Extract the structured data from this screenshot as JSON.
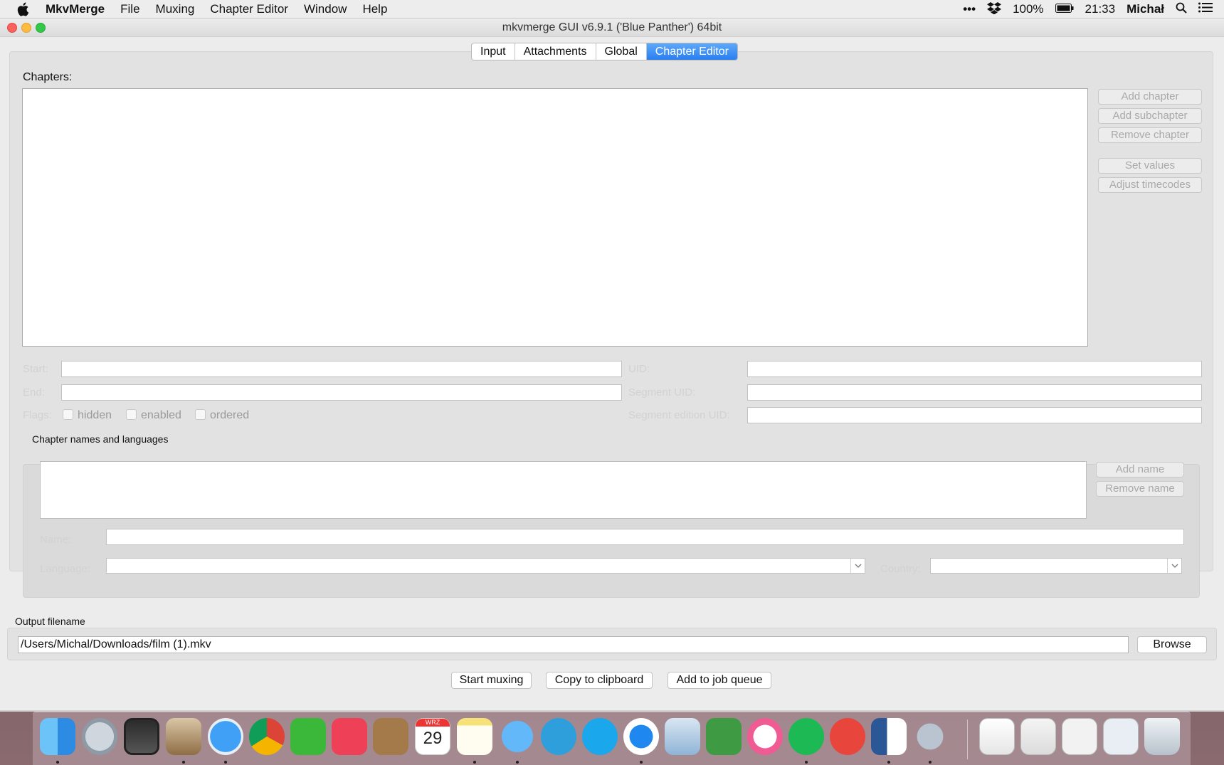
{
  "menubar": {
    "app_name": "MkvMerge",
    "items": [
      "File",
      "Muxing",
      "Chapter Editor",
      "Window",
      "Help"
    ],
    "status": {
      "more": "•••",
      "battery": "100%",
      "time": "21:33",
      "user": "Michał"
    }
  },
  "window": {
    "title": "mkvmerge GUI v6.9.1 ('Blue Panther') 64bit",
    "tabs": [
      "Input",
      "Attachments",
      "Global",
      "Chapter Editor"
    ],
    "active_tab": "Chapter Editor"
  },
  "chapters": {
    "label": "Chapters:",
    "buttons": {
      "add_chapter": "Add chapter",
      "add_subchapter": "Add subchapter",
      "remove_chapter": "Remove chapter",
      "set_values": "Set values",
      "adjust_timecodes": "Adjust timecodes"
    },
    "fields": {
      "start": "Start:",
      "end": "End:",
      "flags": "Flags:",
      "uid": "UID:",
      "segment_uid": "Segment UID:",
      "segment_edition_uid": "Segment edition UID:"
    },
    "flags": {
      "hidden": "hidden",
      "enabled": "enabled",
      "ordered": "ordered"
    }
  },
  "names": {
    "group_label": "Chapter names and languages",
    "add_name": "Add name",
    "remove_name": "Remove name",
    "name_label": "Name:",
    "language_label": "Language:",
    "country_label": "Country:"
  },
  "output": {
    "label": "Output filename",
    "value": "/Users/Michal/Downloads/film (1).mkv",
    "browse": "Browse"
  },
  "actions": {
    "start_muxing": "Start muxing",
    "copy_to_clipboard": "Copy to clipboard",
    "add_to_job_queue": "Add to job queue"
  },
  "dock": {
    "calendar_month": "WRZ",
    "calendar_day": "29",
    "apps": [
      "Finder",
      "Launchpad",
      "Photo Slideshow",
      "Mail",
      "Safari",
      "Chrome",
      "Feedly",
      "Pocket",
      "Contacts",
      "Calendar",
      "Notes",
      "Messages",
      "Telegram",
      "Skype",
      "Messenger",
      "Preview",
      "Evernote",
      "iTunes",
      "Spotify",
      "Downloader",
      "Word",
      "Automator",
      "VLC",
      "Image Viewer",
      "Finder Window",
      "Document",
      "Trash"
    ]
  }
}
